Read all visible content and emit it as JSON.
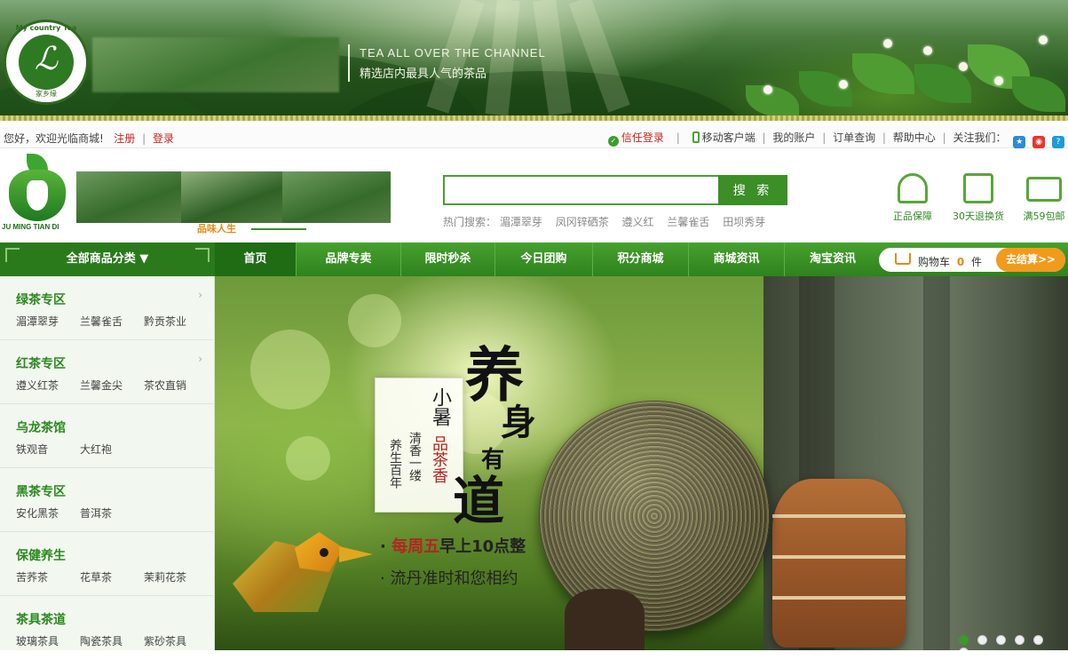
{
  "banner": {
    "emblem_ring_text": "My country Tea",
    "emblem_bottom_text": "家乡缘",
    "tagline_en": "TEA ALL OVER THE CHANNEL",
    "tagline_cn": "精选店内最具人气的茶品"
  },
  "topbar": {
    "welcome": "您好，欢迎光临商城!",
    "register": "注册",
    "login": "登录",
    "trust_login": "信任登录",
    "mobile": "移动客户端",
    "account": "我的账户",
    "orders": "订单查询",
    "help": "帮助中心",
    "follow": "关注我们："
  },
  "header": {
    "logo_text": "JU MING TIAN DI",
    "slogan": "品味人生",
    "search": {
      "value": "",
      "placeholder": "",
      "button": "搜 索"
    },
    "hot_label": "热门搜索：",
    "hot_keywords": [
      "湄潭翠芽",
      "凤冈锌硒茶",
      "遵义红",
      "兰馨雀舌",
      "田坝秀芽"
    ],
    "guarantees": [
      "正品保障",
      "30天退换货",
      "满59包邮"
    ]
  },
  "nav": {
    "all_categories": "全部商品分类 ▼",
    "items": [
      "首页",
      "品牌专卖",
      "限时秒杀",
      "今日团购",
      "积分商城",
      "商城资讯",
      "淘宝资讯"
    ],
    "active_index": 0,
    "cart_label": "购物车",
    "cart_count": "0",
    "cart_unit": "件",
    "checkout": "去结算>>"
  },
  "categories": [
    {
      "title": "绿茶专区",
      "subs": [
        "湄潭翠芽",
        "兰馨雀舌",
        "黔贡茶业"
      ]
    },
    {
      "title": "红茶专区",
      "subs": [
        "遵义红茶",
        "兰馨金尖",
        "茶农直销"
      ]
    },
    {
      "title": "乌龙茶馆",
      "subs": [
        "铁观音",
        "大红袍"
      ]
    },
    {
      "title": "黑茶专区",
      "subs": [
        "安化黑茶",
        "普洱茶"
      ]
    },
    {
      "title": "保健养生",
      "subs": [
        "苦荞茶",
        "花草茶",
        "茉莉花茶"
      ]
    },
    {
      "title": "茶具茶道",
      "subs": [
        "玻璃茶具",
        "陶瓷茶具",
        "紫砂茶具"
      ]
    }
  ],
  "hero": {
    "card_small": "小暑",
    "card_red": "品茶香",
    "card_line1": "清香一缕",
    "card_line2": "养生百年",
    "big_chars": [
      "养",
      "身",
      "有",
      "道"
    ],
    "tagline1_prefix": "· ",
    "tagline1_red": "每周五",
    "tagline1_rest": "早上10点整",
    "tagline2": "· 流丹准时和您相约",
    "slide_count": 6,
    "active_slide": 0
  },
  "colors": {
    "primary_green": "#3b8f26",
    "accent_orange": "#f29a1c",
    "link_red": "#c7241c"
  }
}
